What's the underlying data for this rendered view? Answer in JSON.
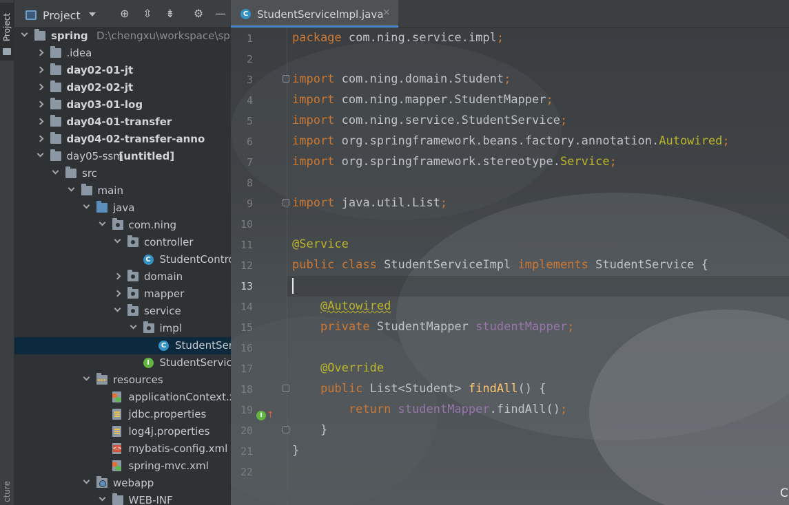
{
  "toolstrip": {
    "project_tab": "Project",
    "bottom_tab": "cture"
  },
  "project_panel": {
    "title": "Project",
    "toolbar_icons": [
      "target-icon",
      "expand-all-icon",
      "collapse-all-icon",
      "gear-icon",
      "minimize-icon"
    ],
    "tree": [
      {
        "label": "spring",
        "path": "D:\\chengxu\\workspace\\spring",
        "icon": "module-folder-icon",
        "expanded": true,
        "bold": true
      },
      {
        "label": ".idea",
        "icon": "folder-icon",
        "expanded": false
      },
      {
        "label": "day02-01-jt",
        "icon": "module-folder-icon",
        "expanded": false,
        "bold": true
      },
      {
        "label": "day02-02-jt",
        "icon": "module-folder-icon",
        "expanded": false,
        "bold": true
      },
      {
        "label": "day03-01-log",
        "icon": "module-folder-icon",
        "expanded": false,
        "bold": true
      },
      {
        "label": "day04-01-transfer",
        "icon": "module-folder-icon",
        "expanded": false,
        "bold": true
      },
      {
        "label": "day04-02-transfer-anno",
        "icon": "module-folder-icon",
        "expanded": false,
        "bold": true
      },
      {
        "label": "day05-ssm",
        "suffix": "[untitled]",
        "icon": "module-folder-icon",
        "expanded": true
      },
      {
        "label": "src",
        "icon": "folder-icon",
        "expanded": true
      },
      {
        "label": "main",
        "icon": "folder-icon",
        "expanded": true
      },
      {
        "label": "java",
        "icon": "source-folder-icon",
        "expanded": true
      },
      {
        "label": "com.ning",
        "icon": "package-icon",
        "expanded": true
      },
      {
        "label": "controller",
        "icon": "package-icon",
        "expanded": true
      },
      {
        "label": "StudentControlle",
        "icon": "class-icon"
      },
      {
        "label": "domain",
        "icon": "package-icon",
        "expanded": false
      },
      {
        "label": "mapper",
        "icon": "package-icon",
        "expanded": false
      },
      {
        "label": "service",
        "icon": "package-icon",
        "expanded": true
      },
      {
        "label": "impl",
        "icon": "package-icon",
        "expanded": true
      },
      {
        "label": "StudentService",
        "icon": "class-icon",
        "selected": true
      },
      {
        "label": "StudentService",
        "icon": "interface-icon"
      },
      {
        "label": "resources",
        "icon": "resources-folder-icon",
        "expanded": true
      },
      {
        "label": "applicationContext.xml",
        "icon": "xml-file-icon"
      },
      {
        "label": "jdbc.properties",
        "icon": "properties-file-icon"
      },
      {
        "label": "log4j.properties",
        "icon": "properties-file-icon"
      },
      {
        "label": "mybatis-config.xml",
        "icon": "mybatis-xml-icon"
      },
      {
        "label": "spring-mvc.xml",
        "icon": "xml-file-icon"
      },
      {
        "label": "webapp",
        "icon": "web-folder-icon",
        "expanded": true
      },
      {
        "label": "WEB-INF",
        "icon": "folder-icon",
        "expanded": true
      }
    ]
  },
  "editor": {
    "tab": {
      "label": "StudentServiceImpl.java",
      "close": "×",
      "icon_letter": "C"
    },
    "current_line": 13,
    "line_numbers": [
      "1",
      "2",
      "3",
      "4",
      "5",
      "6",
      "7",
      "8",
      "9",
      "10",
      "11",
      "12",
      "13",
      "14",
      "15",
      "16",
      "17",
      "18",
      "19",
      "20",
      "21",
      "22"
    ],
    "gutter_icon_letter": "I",
    "gutter_arrow": "↑",
    "code_lines": [
      [
        [
          "kw",
          "package "
        ],
        [
          "id",
          "com.ning.service.impl"
        ],
        [
          "kw",
          ";"
        ]
      ],
      [],
      [
        [
          "kw",
          "import "
        ],
        [
          "id",
          "com.ning.domain.Student"
        ],
        [
          "kw",
          ";"
        ]
      ],
      [
        [
          "kw",
          "import "
        ],
        [
          "id",
          "com.ning.mapper.StudentMapper"
        ],
        [
          "kw",
          ";"
        ]
      ],
      [
        [
          "kw",
          "import "
        ],
        [
          "id",
          "com.ning.service.StudentService"
        ],
        [
          "kw",
          ";"
        ]
      ],
      [
        [
          "kw",
          "import "
        ],
        [
          "id",
          "org.springframework.beans.factory.annotation."
        ],
        [
          "an",
          "Autowired"
        ],
        [
          "kw",
          ";"
        ]
      ],
      [
        [
          "kw",
          "import "
        ],
        [
          "id",
          "org.springframework.stereotype."
        ],
        [
          "an",
          "Service"
        ],
        [
          "kw",
          ";"
        ]
      ],
      [],
      [
        [
          "kw",
          "import "
        ],
        [
          "id",
          "java.util.List"
        ],
        [
          "kw",
          ";"
        ]
      ],
      [],
      [
        [
          "an",
          "@Service"
        ]
      ],
      [
        [
          "kw",
          "public class "
        ],
        [
          "id",
          "StudentServiceImpl "
        ],
        [
          "kw",
          "implements "
        ],
        [
          "id",
          "StudentService {"
        ]
      ],
      [],
      [
        [
          "id",
          "    "
        ],
        [
          "an squig",
          "@Autowired"
        ]
      ],
      [
        [
          "id",
          "    "
        ],
        [
          "kw",
          "private "
        ],
        [
          "id",
          "StudentMapper "
        ],
        [
          "fd",
          "studentMapper"
        ],
        [
          "kw",
          ";"
        ]
      ],
      [],
      [
        [
          "id",
          "    "
        ],
        [
          "an",
          "@Override"
        ]
      ],
      [
        [
          "id",
          "    "
        ],
        [
          "kw",
          "public "
        ],
        [
          "id",
          "List<Student> "
        ],
        [
          "mt",
          "findAll"
        ],
        [
          "id",
          "() {"
        ]
      ],
      [
        [
          "id",
          "        "
        ],
        [
          "kw",
          "return "
        ],
        [
          "fd",
          "studentMapper"
        ],
        [
          "id",
          ".findAll()"
        ],
        [
          "kw",
          ";"
        ]
      ],
      [
        [
          "id",
          "    }"
        ]
      ],
      [
        [
          "id",
          "}"
        ]
      ],
      []
    ]
  },
  "watermark": "CSDN @专吃海绵宝宝菠萝屋的派大星"
}
